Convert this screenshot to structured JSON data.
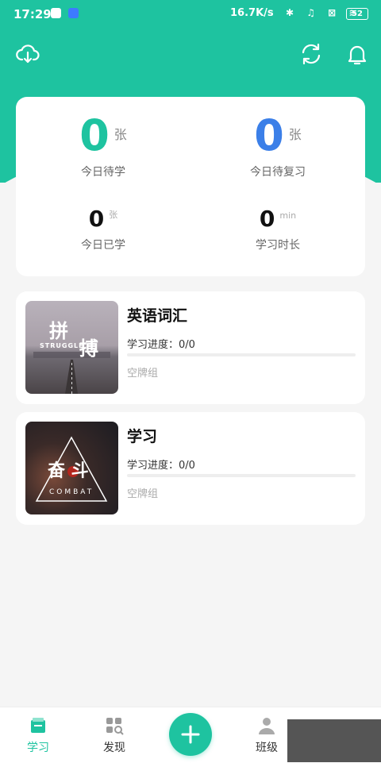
{
  "status_bar": {
    "time": "17:29",
    "network_speed": "16.7K/s",
    "battery": "52"
  },
  "colors": {
    "accent": "#1ec3a0",
    "blue": "#3b7fe8"
  },
  "header": {
    "icons": [
      "cloud-download-icon",
      "refresh-icon",
      "bell-icon"
    ]
  },
  "stats": {
    "to_learn": {
      "value": "0",
      "unit": "张",
      "label": "今日待学"
    },
    "to_review": {
      "value": "0",
      "unit": "张",
      "label": "今日待复习"
    },
    "learned": {
      "value": "0",
      "unit": "张",
      "label": "今日已学"
    },
    "duration": {
      "value": "0",
      "unit": "min",
      "label": "学习时长"
    }
  },
  "decks": [
    {
      "name": "英语词汇",
      "progress_label": "学习进度：0/0",
      "progress_fraction": 0,
      "status": "空牌组",
      "cover_text_main": "拼",
      "cover_text_second": "搏",
      "cover_text_sub": "STRUGGLE"
    },
    {
      "name": "学习",
      "progress_label": "学习进度：0/0",
      "progress_fraction": 0,
      "status": "空牌组",
      "cover_text_main": "奋 斗",
      "cover_text_sub": "COMBAT"
    }
  ],
  "tabbar": {
    "tabs": [
      {
        "label": "学习",
        "icon": "study-icon",
        "active": true
      },
      {
        "label": "发现",
        "icon": "discover-icon",
        "active": false
      },
      {
        "label": "班级",
        "icon": "class-icon",
        "active": false
      }
    ],
    "add_button_icon": "plus-icon"
  }
}
